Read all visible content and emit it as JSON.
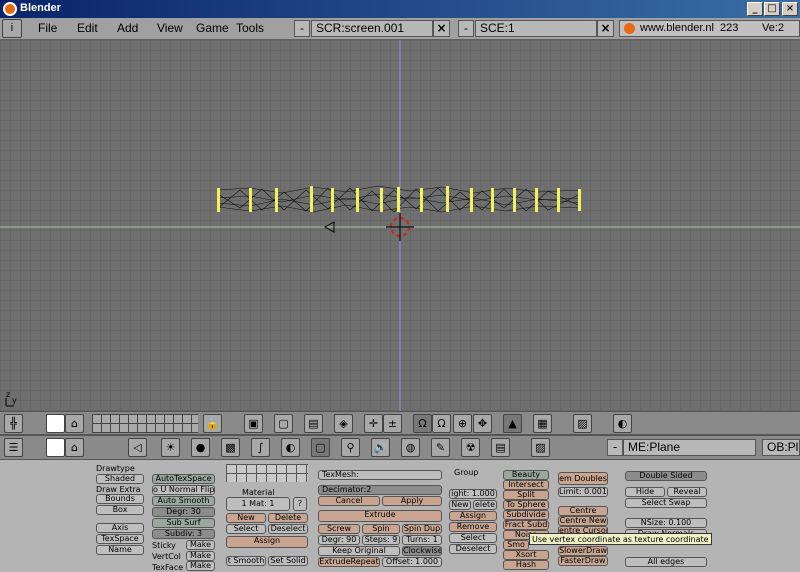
{
  "window": {
    "title": "Blender"
  },
  "menu": {
    "items": [
      "File",
      "Edit",
      "Add",
      "View",
      "Game",
      "Tools"
    ],
    "screen": "SCR:screen.001",
    "scene": "SCE:1",
    "url": "www.blender.nl",
    "version_num": "223",
    "version": "Ve:2"
  },
  "viewport": {
    "axis_z": "z",
    "axis_y": "y"
  },
  "header": {
    "mesh_name": "ME:Plane",
    "object_name": "OB:Pl"
  },
  "editing": {
    "drawtype_label": "Drawtype",
    "drawtype": "Shaded",
    "draw_extra": "Draw Extra",
    "bounds": "Bounds",
    "box": "Box",
    "axis": "Axis",
    "texspace": "TexSpace",
    "name": "Name",
    "autotexspace": "AutoTexSpace",
    "normal_flip": "o U Normal Flip",
    "auto_smooth": "Auto Smooth",
    "degr": "Degr: 30",
    "subsurf": "Sub Surf",
    "subdiv": "Subdiv: 3",
    "sticky": "Sticky",
    "vertcol": "VertCol",
    "texface": "TexFace",
    "make": "Make",
    "material": "Material",
    "mat": "1 Mat: 1",
    "q": "?",
    "new": "New",
    "delete": "Delete",
    "select": "Select",
    "deselect": "Deselect",
    "assign": "Assign",
    "set_smooth": "t Smooth",
    "set_solid": "Set Solid",
    "texmesh": "TexMesh:",
    "decimator": "Decimator:2",
    "cancel": "Cancel",
    "apply": "Apply",
    "extrude": "Extrude",
    "screw": "Screw",
    "spin": "Spin",
    "spin_dup": "Spin Dup",
    "degr90": "Degr: 90",
    "steps": "Steps: 9",
    "turns": "Turns: 1",
    "keep_original": "Keep Original",
    "clockwise": "Clockwise",
    "extrude_repeat": "ExtrudeRepeat",
    "offset": "Offset: 1.000",
    "group": "Group",
    "weight": "ight: 1.000",
    "grp_new": "New",
    "grp_delete": "elete",
    "grp_assign": "Assign",
    "grp_remove": "Remove",
    "grp_select": "Select",
    "grp_deselect": "Deselect",
    "beauty": "Beauty",
    "intersect": "Intersect",
    "split": "Split",
    "to_sphere": "To Sphere",
    "subdivide": "Subdivide",
    "fract_subd": "Fract Subd",
    "noise": "Noise",
    "smooth": "Smo",
    "xsort": "Xsort",
    "hash": "Hash",
    "rem_doubles": "em Doubles",
    "limit": "Limit: 0.001",
    "centre": "Centre",
    "centre_new": "Centre New",
    "centre_cursor": "entre Cursor",
    "slower_draw": "SlowerDraw",
    "faster_draw": "FasterDraw",
    "double_sided": "Double Sided",
    "hide": "Hide",
    "reveal": "Reveal",
    "select_swap": "Select Swap",
    "nsize": "NSize: 0.100",
    "draw_normals": "Draw Normals",
    "all_edges": "All edges"
  },
  "tooltip": "Use vertex coordinate as texture coordinate"
}
